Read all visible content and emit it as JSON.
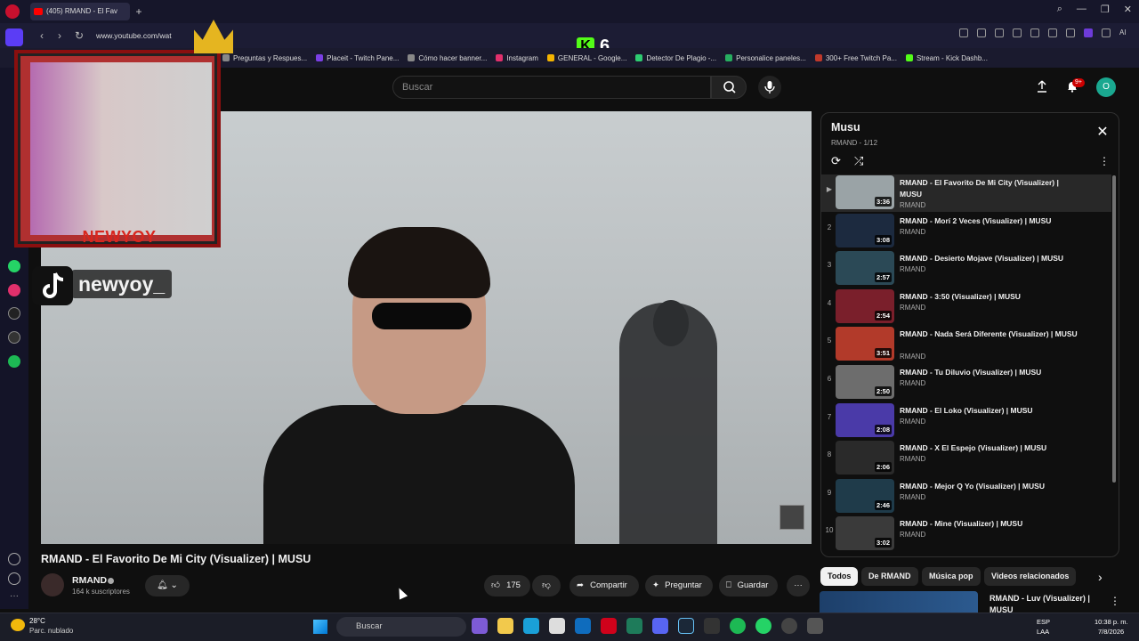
{
  "browser": {
    "tab_title": "(405) RMAND - El Fav",
    "url": "www.youtube.com/wat",
    "kick_count": "6",
    "bookmarks": [
      "Preguntas y Respues...",
      "Placeit - Twitch Pane...",
      "Cómo hacer banner...",
      "Instagram",
      "GENERAL - Google...",
      "Detector De Plagio -...",
      "Personalice paneles...",
      "300+ Free Twitch Pa...",
      "Stream - Kick Dashb..."
    ]
  },
  "youtube": {
    "search_placeholder": "Buscar",
    "notification_count": "9+",
    "avatar_letter": "O"
  },
  "overlay": {
    "facecam_name": "NEWYOY",
    "tiktok_handle": "newyoy_"
  },
  "video": {
    "title": "RMAND - El Favorito De Mi City (Visualizer) | MUSU",
    "channel": "RMAND",
    "subscribers": "164 k suscriptores",
    "likes": "175",
    "share_label": "Compartir",
    "ask_label": "Preguntar",
    "save_label": "Guardar"
  },
  "playlist": {
    "title": "Musu",
    "subtitle": "RMAND - 1/12",
    "items": [
      {
        "idx": "▶",
        "title": "RMAND - El Favorito De Mi City (Visualizer) | MUSU",
        "channel": "RMAND",
        "duration": "3:36",
        "color": "#9aa3a6"
      },
      {
        "idx": "2",
        "title": "RMAND - Morí 2 Veces (Visualizer) | MUSU",
        "channel": "RMAND",
        "duration": "3:08",
        "color": "#1c2a3f"
      },
      {
        "idx": "3",
        "title": "RMAND - Desierto Mojave (Visualizer) | MUSU",
        "channel": "RMAND",
        "duration": "2:57",
        "color": "#2b4956"
      },
      {
        "idx": "4",
        "title": "RMAND - 3:50 (Visualizer) | MUSU",
        "channel": "RMAND",
        "duration": "2:54",
        "color": "#7a1f2b"
      },
      {
        "idx": "5",
        "title": "RMAND - Nada Será Diferente (Visualizer) | MUSU",
        "channel": "RMAND",
        "duration": "3:51",
        "color": "#b23a2a"
      },
      {
        "idx": "6",
        "title": "RMAND - Tu Diluvio (Visualizer) | MUSU",
        "channel": "RMAND",
        "duration": "2:50",
        "color": "#6d6d6d"
      },
      {
        "idx": "7",
        "title": "RMAND - El Loko (Visualizer) | MUSU",
        "channel": "RMAND",
        "duration": "2:08",
        "color": "#4a3aa8"
      },
      {
        "idx": "8",
        "title": "RMAND - X El Espejo (Visualizer) | MUSU",
        "channel": "RMAND",
        "duration": "2:06",
        "color": "#2a2a2a"
      },
      {
        "idx": "9",
        "title": "RMAND - Mejor Q Yo (Visualizer) | MUSU",
        "channel": "RMAND",
        "duration": "2:46",
        "color": "#1f3b4a"
      },
      {
        "idx": "10",
        "title": "RMAND - Mine (Visualizer) | MUSU",
        "channel": "RMAND",
        "duration": "3:02",
        "color": "#3a3a3a"
      }
    ]
  },
  "chips": [
    "Todos",
    "De RMAND",
    "Música pop",
    "Videos relacionados"
  ],
  "related": {
    "title": "RMAND - Luv (Visualizer) | MUSU"
  },
  "taskbar": {
    "temp": "28°C",
    "weather": "Parc. nublado",
    "search": "Buscar",
    "lang1": "ESP",
    "lang2": "LAA",
    "time": "10:38 p. m.",
    "date": "7/8/2026"
  }
}
